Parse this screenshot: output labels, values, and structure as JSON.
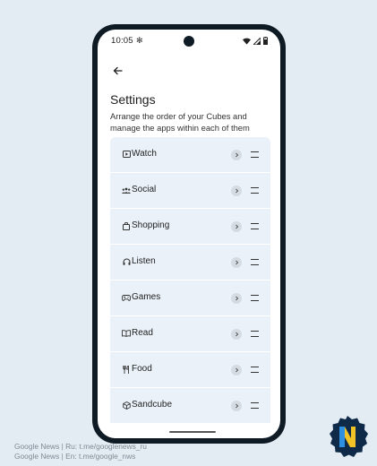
{
  "status": {
    "time": "10:05"
  },
  "header": {
    "title": "Settings",
    "subtitle": "Arrange the order of your Cubes and manage the apps within each of them"
  },
  "cubes": [
    {
      "label": "Watch",
      "icon": "play-box-icon"
    },
    {
      "label": "Social",
      "icon": "people-icon"
    },
    {
      "label": "Shopping",
      "icon": "shopping-bag-icon"
    },
    {
      "label": "Listen",
      "icon": "headphones-icon"
    },
    {
      "label": "Games",
      "icon": "gamepad-icon"
    },
    {
      "label": "Read",
      "icon": "book-icon"
    },
    {
      "label": "Food",
      "icon": "fork-knife-icon"
    },
    {
      "label": "Sandcube",
      "icon": "cube-icon"
    }
  ],
  "watermark": {
    "line1": "Google News | Ru: t.me/googlenews_ru",
    "line2": "Google News | En: t.me/google_nws"
  },
  "colors": {
    "background": "#e3ebf3",
    "row": "#eaf1f9",
    "frame": "#0e1a24"
  }
}
